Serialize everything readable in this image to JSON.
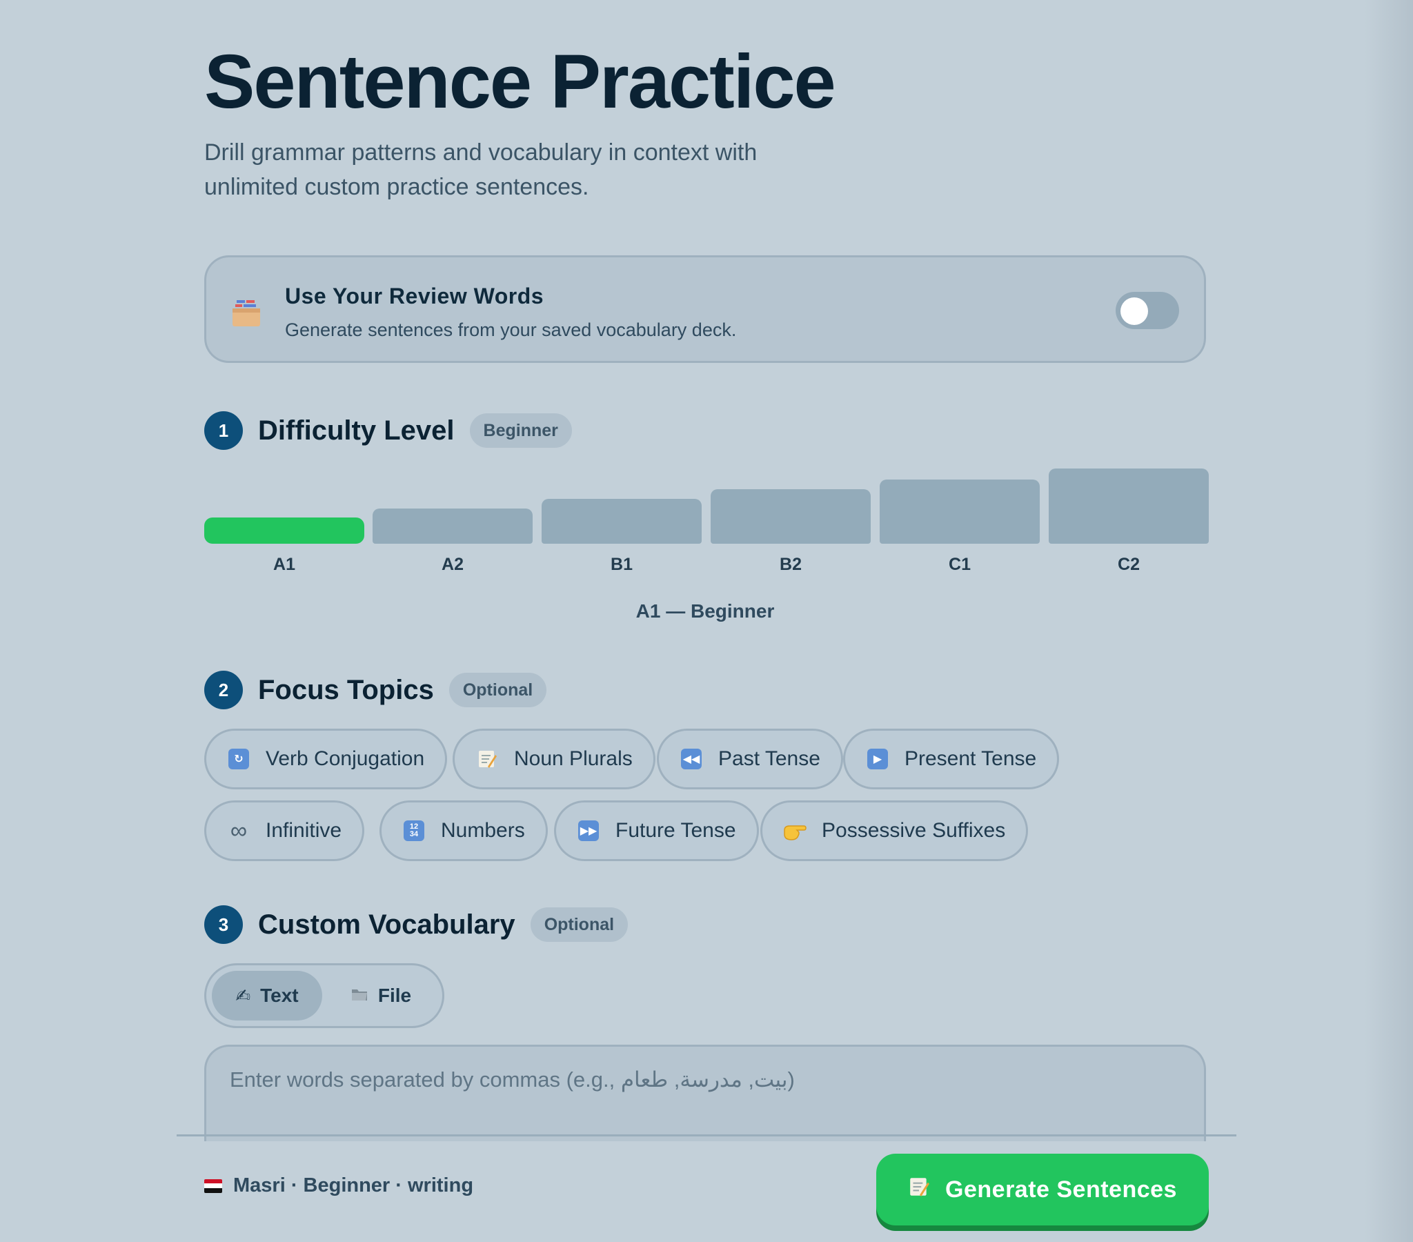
{
  "header": {
    "title": "Sentence Practice",
    "subtitle": "Drill grammar patterns and vocabulary in context with unlimited custom practice sentences."
  },
  "review_words": {
    "icon": "card-file-box-icon",
    "title": "Use Your Review Words",
    "description": "Generate sentences from your saved vocabulary deck.",
    "enabled": false
  },
  "difficulty": {
    "step": "1",
    "title": "Difficulty Level",
    "badge": "Beginner",
    "levels": [
      "A1",
      "A2",
      "B1",
      "B2",
      "C1",
      "C2"
    ],
    "selected": "A1",
    "caption": "A1 — Beginner",
    "active_color": "#22c55e"
  },
  "focus_topics": {
    "step": "2",
    "title": "Focus Topics",
    "badge": "Optional",
    "topics": [
      {
        "label": "Verb Conjugation",
        "icon": "repeat-arrows-icon"
      },
      {
        "label": "Noun Plurals",
        "icon": "memo-icon"
      },
      {
        "label": "Past Tense",
        "icon": "rewind-icon"
      },
      {
        "label": "Present Tense",
        "icon": "play-icon"
      },
      {
        "label": "Infinitive",
        "icon": "infinity-icon"
      },
      {
        "label": "Numbers",
        "icon": "numbers-1234-icon"
      },
      {
        "label": "Future Tense",
        "icon": "fast-forward-icon"
      },
      {
        "label": "Possessive Suffixes",
        "icon": "pointing-hand-icon"
      }
    ]
  },
  "custom_vocab": {
    "step": "3",
    "title": "Custom Vocabulary",
    "badge": "Optional",
    "modes": [
      {
        "label": "Text",
        "icon": "writing-hand-icon",
        "active": true
      },
      {
        "label": "File",
        "icon": "folder-icon",
        "active": false
      }
    ],
    "placeholder": "Enter words separated by commas (e.g., بيت, مدرسة, طعام)",
    "value": ""
  },
  "footer": {
    "flag": "egypt-flag-icon",
    "meta": "Masri · Beginner · writing",
    "generate_label": "Generate Sentences",
    "generate_icon": "memo-icon"
  }
}
